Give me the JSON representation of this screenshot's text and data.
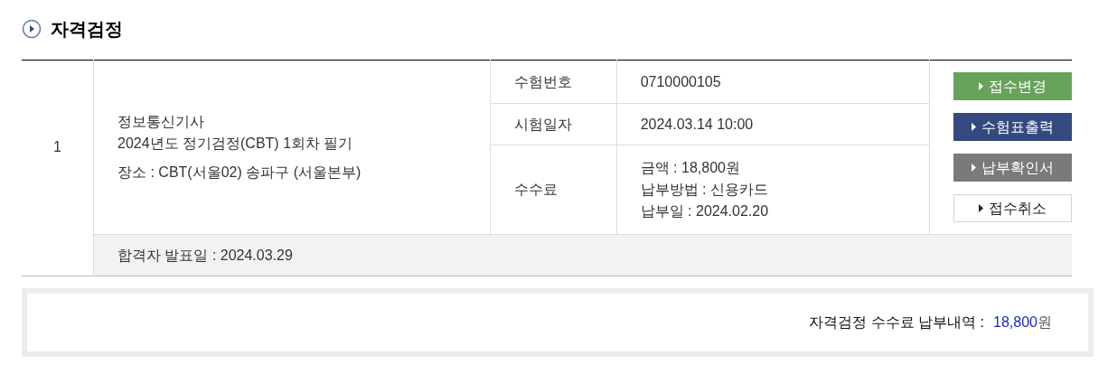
{
  "section_title": "자격검정",
  "row": {
    "number": "1",
    "exam_lines": [
      "정보통신기사",
      "2024년도 정기검정(CBT) 1회차 필기"
    ],
    "place": "장소 : CBT(서울02) 송파구 (서울본부)",
    "details": [
      {
        "label": "수험번호",
        "values": [
          "0710000105"
        ]
      },
      {
        "label": "시험일자",
        "values": [
          "2024.03.14 10:00"
        ]
      },
      {
        "label": "수수료",
        "values": [
          "금액 : 18,800원",
          "납부방법 : 신용카드",
          "납부일 : 2024.02.20"
        ]
      }
    ],
    "buttons": [
      {
        "label": "접수변경",
        "kind": "green"
      },
      {
        "label": "수험표출력",
        "kind": "navy"
      },
      {
        "label": "납부확인서",
        "kind": "gray"
      },
      {
        "label": "접수취소",
        "kind": "outline"
      }
    ],
    "announcement": "합격자 발표일 : 2024.03.29"
  },
  "summary": {
    "label": "자격검정 수수료 납부내역 :",
    "amount": "18,800",
    "unit": "원"
  }
}
